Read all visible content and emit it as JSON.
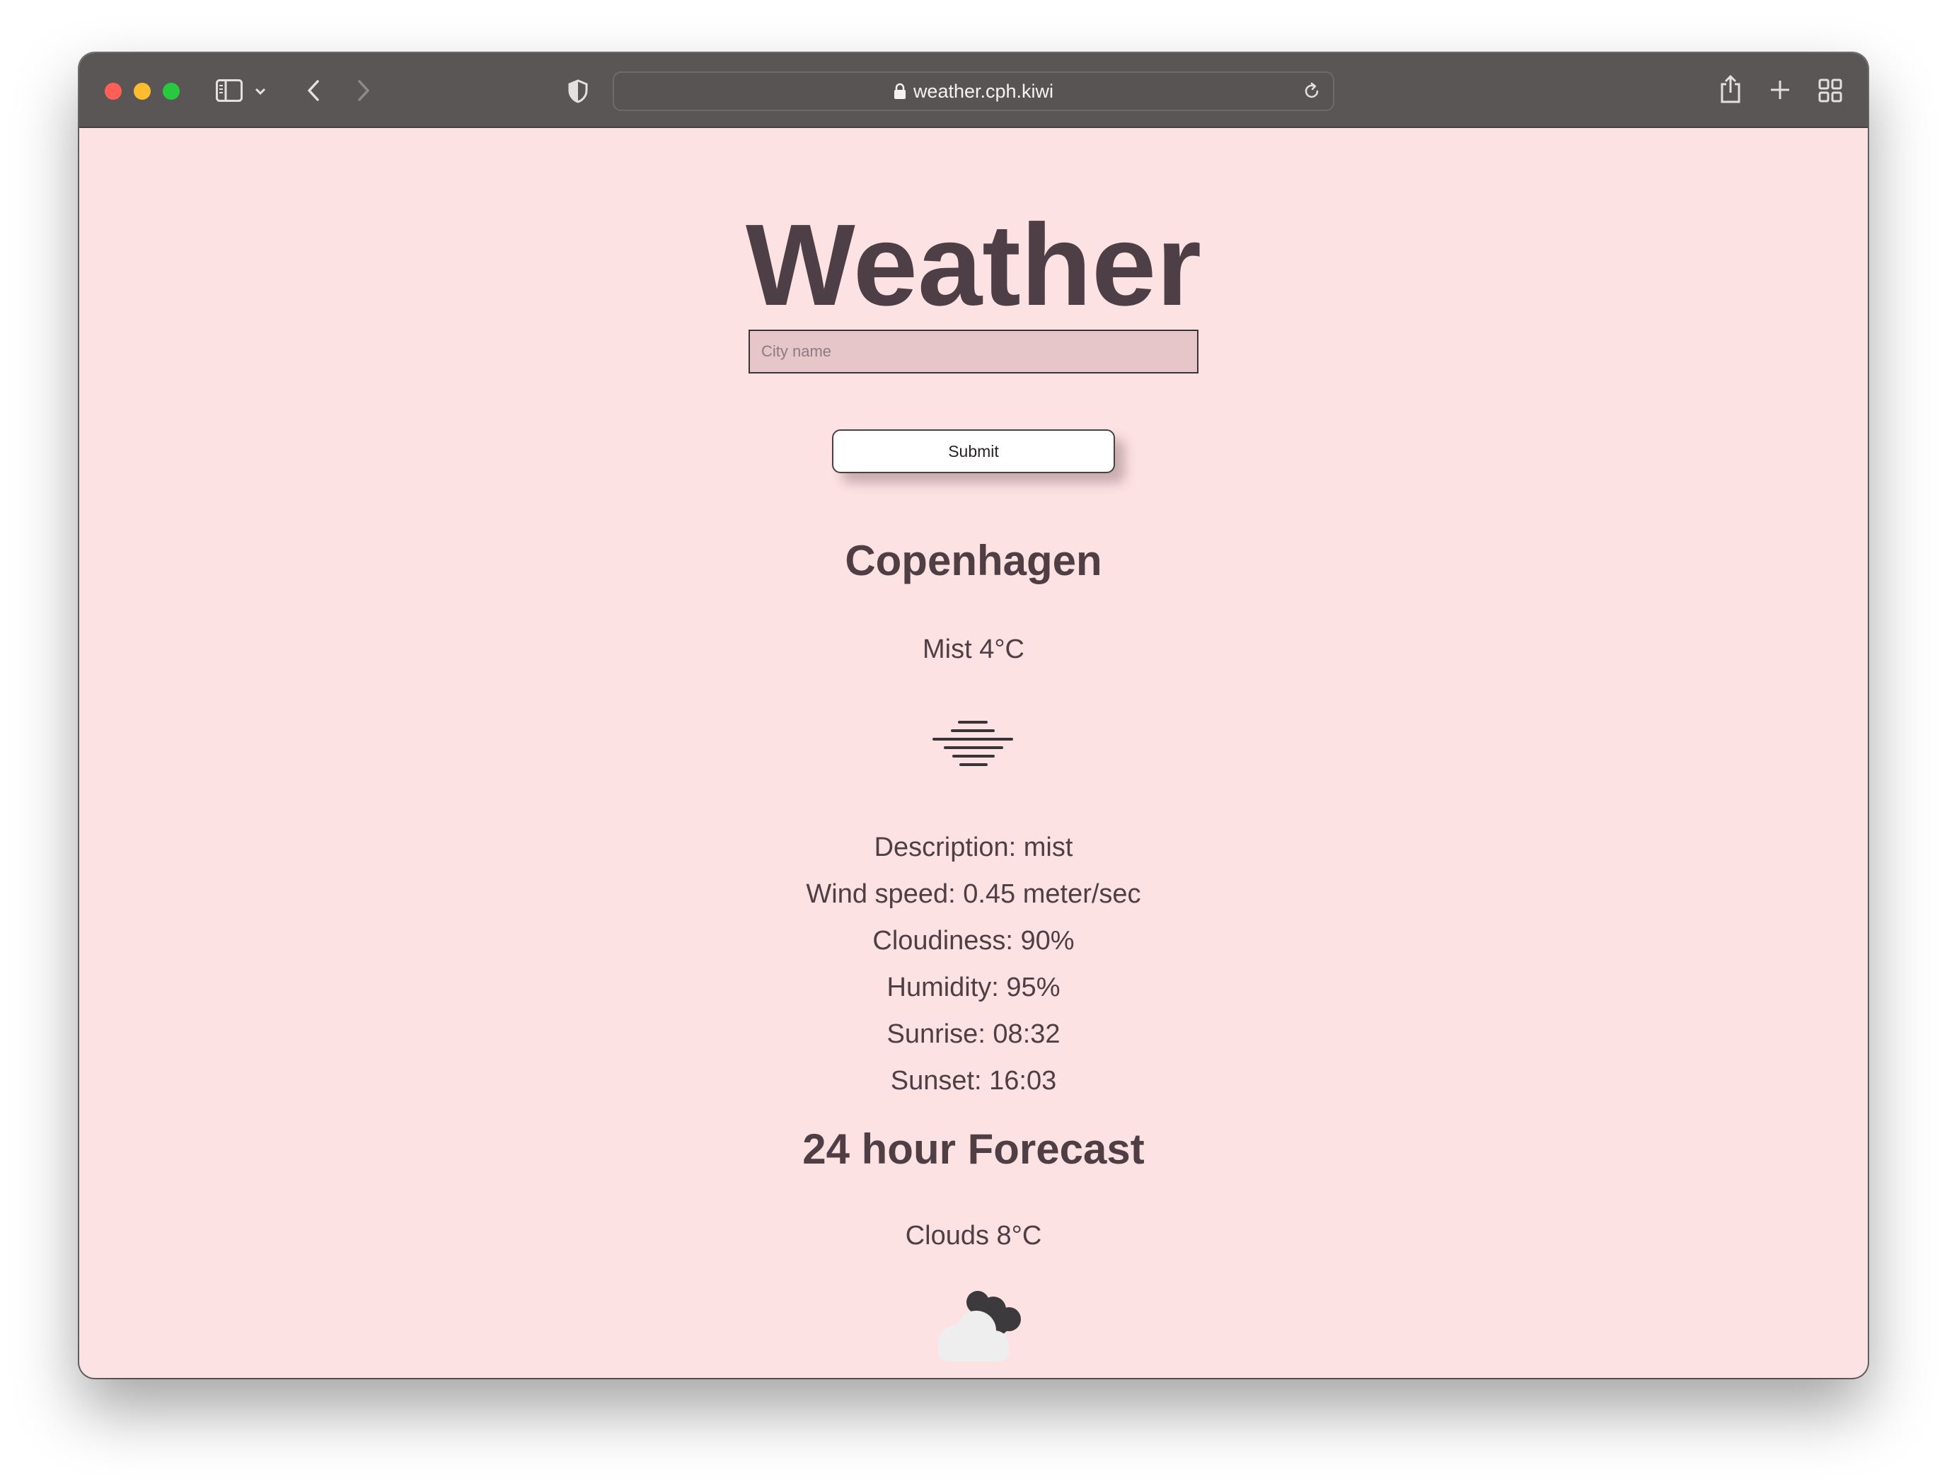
{
  "browser": {
    "url": "weather.cph.kiwi",
    "traffic_light_colors": [
      "#ff5f57",
      "#febc2e",
      "#28c840"
    ]
  },
  "page": {
    "title": "Weather",
    "search": {
      "placeholder": "City name",
      "value": ""
    },
    "submit_label": "Submit",
    "city": "Copenhagen",
    "current_summary": "Mist 4°C",
    "current_icon": "mist-icon",
    "details": [
      "Description: mist",
      "Wind speed: 0.45 meter/sec",
      "Cloudiness: 90%",
      "Humidity: 95%",
      "Sunrise: 08:32",
      "Sunset: 16:03"
    ],
    "forecast_title": "24 hour Forecast",
    "forecast_summary": "Clouds 8°C",
    "forecast_icon": "broken-clouds-icon"
  },
  "colors": {
    "page_background": "#fde2e3",
    "text": "#4d3f45",
    "input_background": "#e6c6c8",
    "titlebar": "#5b5656"
  }
}
